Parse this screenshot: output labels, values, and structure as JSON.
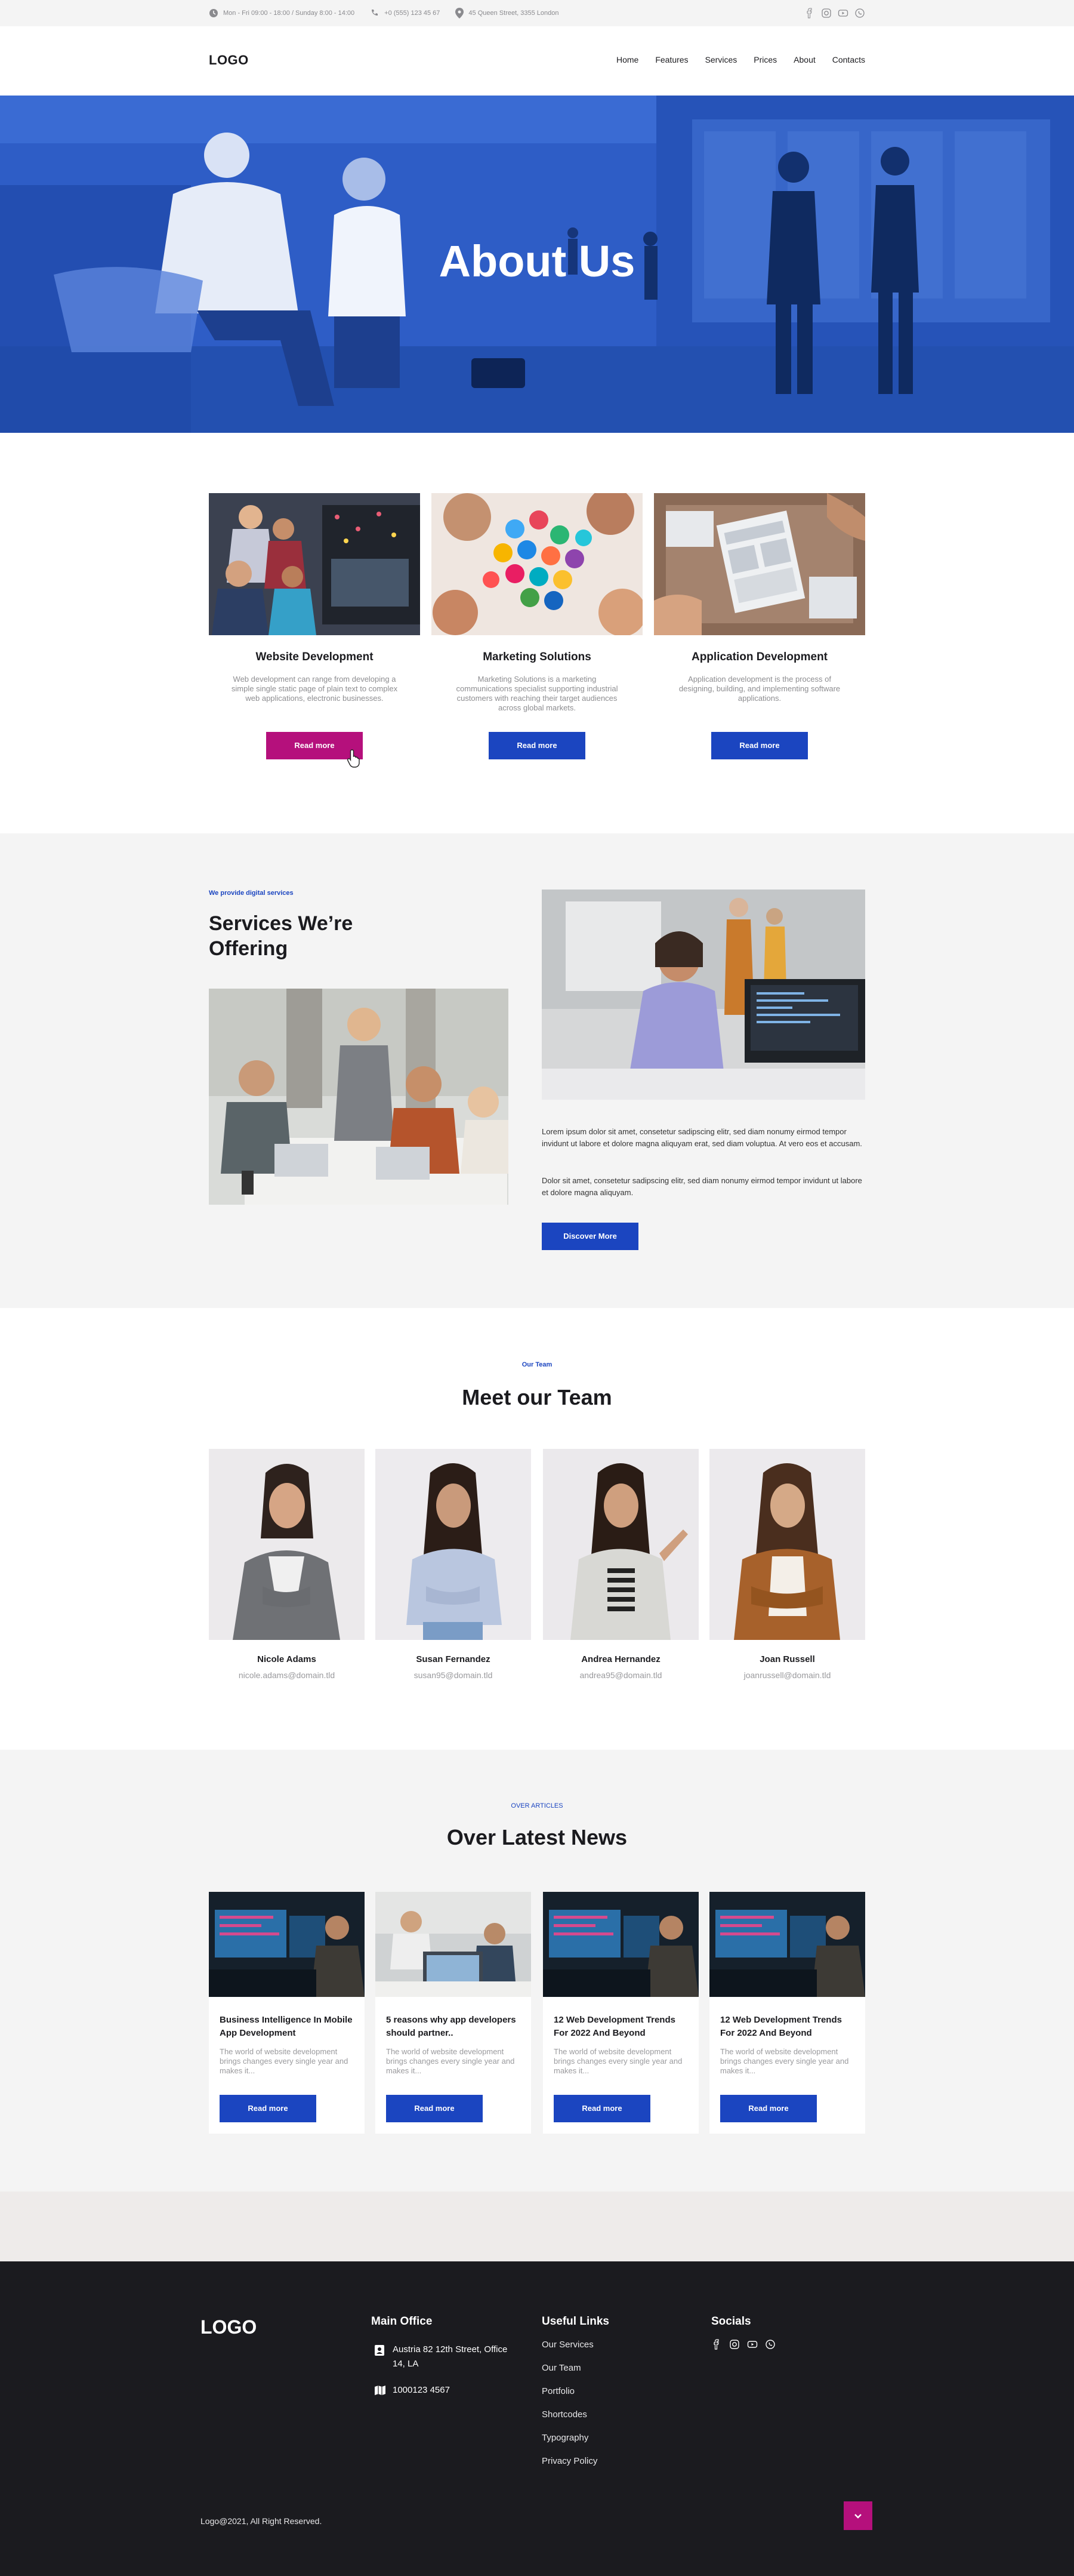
{
  "topbar": {
    "hours": "Mon - Fri 09:00 - 18:00 / Sunday 8:00 - 14:00",
    "phone": "+0 (555) 123 45 67",
    "address": "45 Queen Street, 3355 London",
    "social_icons": [
      "facebook-icon",
      "instagram-icon",
      "youtube-icon",
      "whatsapp-icon"
    ]
  },
  "header": {
    "logo": "LOGO",
    "nav": [
      "Home",
      "Features",
      "Services",
      "Prices",
      "About",
      "Contacts"
    ]
  },
  "hero": {
    "title": "About Us"
  },
  "services": [
    {
      "title": "Website Development",
      "text": "Web development can range from developing a simple single static page of plain text to complex web applications, electronic businesses.",
      "button": "Read more"
    },
    {
      "title": "Marketing Solutions",
      "text": "Marketing Solutions is a marketing communications specialist supporting industrial customers with reaching their target audiences across global markets.",
      "button": "Read more"
    },
    {
      "title": "Application Development",
      "text": "Application development is the process of designing, building, and implementing software applications.",
      "button": "Read more"
    }
  ],
  "offering": {
    "eyebrow": "We provide digital services",
    "title_line1": "Services We’re",
    "title_line2": "Offering",
    "para1": "Lorem ipsum dolor sit amet, consetetur sadipscing elitr, sed diam nonumy eirmod tempor invidunt ut labore et dolore magna aliquyam erat, sed diam voluptua. At vero eos et accusam.",
    "para2": "Dolor sit amet, consetetur sadipscing elitr, sed diam nonumy eirmod tempor invidunt ut labore et dolore magna aliquyam.",
    "button": "Discover More"
  },
  "team": {
    "eyebrow": "Our Team",
    "title": "Meet our Team",
    "members": [
      {
        "name": "Nicole Adams",
        "email": "nicole.adams@domain.tld"
      },
      {
        "name": "Susan Fernandez",
        "email": "susan95@domain.tld"
      },
      {
        "name": "Andrea Hernandez",
        "email": "andrea95@domain.tld"
      },
      {
        "name": "Joan Russell",
        "email": "joanrussell@domain.tld"
      }
    ]
  },
  "news": {
    "eyebrow": "OVER ARTICLES",
    "title": "Over Latest News",
    "posts": [
      {
        "title": "Business Intelligence In Mobile App Development",
        "excerpt": "The world of website development brings changes every single year and makes it...",
        "button": "Read more"
      },
      {
        "title": "5 reasons why app developers should partner..",
        "excerpt": "The world of website development brings changes every single year and makes it...",
        "button": "Read more"
      },
      {
        "title": "12 Web Development Trends For 2022 And Beyond",
        "excerpt": "The world of website development brings changes every single year and makes it...",
        "button": "Read more"
      },
      {
        "title": "12 Web Development Trends For 2022 And Beyond",
        "excerpt": "The world of website development brings changes every single year and makes it...",
        "button": "Read more"
      }
    ]
  },
  "footer": {
    "logo": "LOGO",
    "office_title": "Main Office",
    "office_address": "Austria 82 12th Street, Office 14, LA",
    "office_phone": "1000123 4567",
    "links_title": "Useful Links",
    "links": [
      "Our Services",
      "Our Team",
      "Portfolio",
      "Shortcodes",
      "Typography",
      "Privacy Policy"
    ],
    "socials_title": "Socials",
    "copyright": "Logo@2021, All Right Reserved."
  },
  "colors": {
    "accent": "#1b45c0",
    "highlight": "#b5107c",
    "footer_bg": "#1b1b1f",
    "section_bg": "#f4f4f4"
  }
}
